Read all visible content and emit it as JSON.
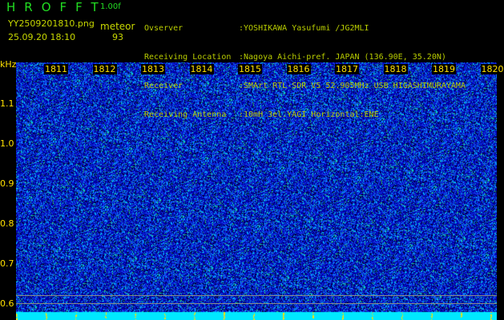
{
  "header": {
    "app": "HROFFT",
    "version": "1.00f",
    "filename": "YY2509201810.png",
    "datetime": "25.09.20 18:10",
    "mode": "meteor",
    "count": "93"
  },
  "info": [
    {
      "k": "Ovserver",
      "v": ":YOSHIKAWA Yasufumi /JG2MLI"
    },
    {
      "k": "Receiving Location",
      "v": ":Nagoya Aichi-pref. JAPAN (136.90E, 35.20N)"
    },
    {
      "k": "Receiver",
      "v": ":SMArt RTL-SDR V5 52.905MHz USB HIGASHIMURAYAMA"
    },
    {
      "k": "Receiving Antenna",
      "v": ":10mH 3el.YAGI Horizontal:ENE"
    }
  ],
  "axis": {
    "unit": "kHz",
    "y_ticks": [
      "1.1",
      "1.0",
      "0.9",
      "0.8",
      "0.7",
      "0.6"
    ],
    "x_ticks": [
      "1811",
      "1812",
      "1813",
      "1814",
      "1815",
      "1816",
      "1817",
      "1818",
      "1819",
      "1820"
    ]
  },
  "colors": {
    "background": "#0000a0",
    "noise": "#2040ff",
    "strip": "#00e8ff",
    "marker": "#ffe000"
  }
}
